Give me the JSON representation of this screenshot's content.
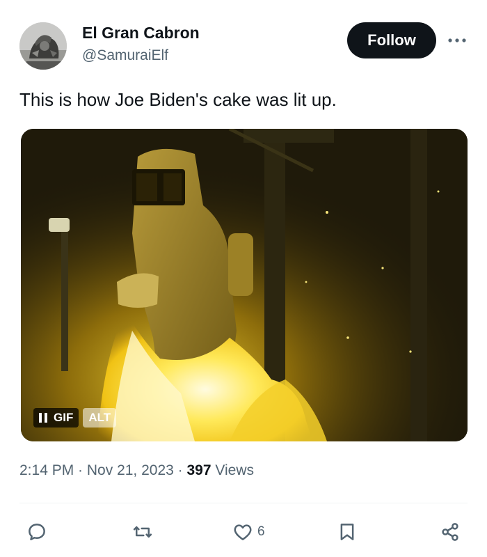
{
  "author": {
    "display_name": "El Gran Cabron",
    "handle": "@SamuraiElf",
    "avatar_icon": "samurai-statue-avatar"
  },
  "header": {
    "follow_label": "Follow",
    "more_icon": "more-horizontal-icon"
  },
  "tweet": {
    "text": "This is how Joe Biden's cake was lit up."
  },
  "media": {
    "type": "gif",
    "gif_label": "GIF",
    "alt_label": "ALT",
    "pause_icon": "pause-icon"
  },
  "meta": {
    "time": "2:14 PM",
    "separator": " · ",
    "date": "Nov 21, 2023",
    "separator2": " · ",
    "views_count": "397",
    "views_label": " Views"
  },
  "actions": {
    "reply_icon": "reply-icon",
    "retweet_icon": "retweet-icon",
    "like_icon": "heart-icon",
    "like_count": "6",
    "bookmark_icon": "bookmark-icon",
    "share_icon": "share-icon"
  },
  "colors": {
    "text_primary": "#0f1419",
    "text_secondary": "#536471",
    "button_bg": "#0f1419",
    "divider": "#eff3f4"
  }
}
